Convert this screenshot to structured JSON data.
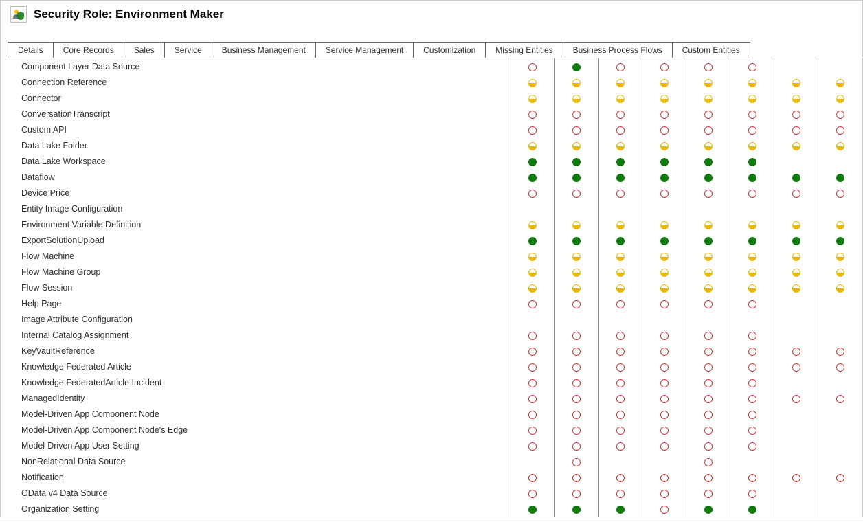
{
  "header": {
    "title": "Security Role: Environment Maker"
  },
  "tabs": [
    "Details",
    "Core Records",
    "Sales",
    "Service",
    "Business Management",
    "Service Management",
    "Customization",
    "Missing Entities",
    "Business Process Flows",
    "Custom Entities"
  ],
  "privilegeLevels": {
    "none": "None",
    "user": "User",
    "org": "Organization",
    "blank": ""
  },
  "entities": [
    {
      "name": "Component Layer Data Source",
      "privs": [
        "none",
        "org",
        "none",
        "none",
        "none",
        "none",
        "blank",
        "blank"
      ]
    },
    {
      "name": "Connection Reference",
      "privs": [
        "user",
        "user",
        "user",
        "user",
        "user",
        "user",
        "user",
        "user"
      ]
    },
    {
      "name": "Connector",
      "privs": [
        "user",
        "user",
        "user",
        "user",
        "user",
        "user",
        "user",
        "user"
      ]
    },
    {
      "name": "ConversationTranscript",
      "privs": [
        "none",
        "none",
        "none",
        "none",
        "none",
        "none",
        "none",
        "none"
      ]
    },
    {
      "name": "Custom API",
      "privs": [
        "none",
        "none",
        "none",
        "none",
        "none",
        "none",
        "none",
        "none"
      ]
    },
    {
      "name": "Data Lake Folder",
      "privs": [
        "user",
        "user",
        "user",
        "user",
        "user",
        "user",
        "user",
        "user"
      ]
    },
    {
      "name": "Data Lake Workspace",
      "privs": [
        "org",
        "org",
        "org",
        "org",
        "org",
        "org",
        "blank",
        "blank"
      ]
    },
    {
      "name": "Dataflow",
      "privs": [
        "org",
        "org",
        "org",
        "org",
        "org",
        "org",
        "org",
        "org"
      ]
    },
    {
      "name": "Device Price",
      "privs": [
        "none",
        "none",
        "none",
        "none",
        "none",
        "none",
        "none",
        "none"
      ]
    },
    {
      "name": "Entity Image Configuration",
      "privs": [
        "blank",
        "blank",
        "blank",
        "blank",
        "blank",
        "blank",
        "blank",
        "blank"
      ]
    },
    {
      "name": "Environment Variable Definition",
      "privs": [
        "user",
        "user",
        "user",
        "user",
        "user",
        "user",
        "user",
        "user"
      ]
    },
    {
      "name": "ExportSolutionUpload",
      "privs": [
        "org",
        "org",
        "org",
        "org",
        "org",
        "org",
        "org",
        "org"
      ]
    },
    {
      "name": "Flow Machine",
      "privs": [
        "user",
        "user",
        "user",
        "user",
        "user",
        "user",
        "user",
        "user"
      ]
    },
    {
      "name": "Flow Machine Group",
      "privs": [
        "user",
        "user",
        "user",
        "user",
        "user",
        "user",
        "user",
        "user"
      ]
    },
    {
      "name": "Flow Session",
      "privs": [
        "user",
        "user",
        "user",
        "user",
        "user",
        "user",
        "user",
        "user"
      ]
    },
    {
      "name": "Help Page",
      "privs": [
        "none",
        "none",
        "none",
        "none",
        "none",
        "none",
        "blank",
        "blank"
      ]
    },
    {
      "name": "Image Attribute Configuration",
      "privs": [
        "blank",
        "blank",
        "blank",
        "blank",
        "blank",
        "blank",
        "blank",
        "blank"
      ]
    },
    {
      "name": "Internal Catalog Assignment",
      "privs": [
        "none",
        "none",
        "none",
        "none",
        "none",
        "none",
        "blank",
        "blank"
      ]
    },
    {
      "name": "KeyVaultReference",
      "privs": [
        "none",
        "none",
        "none",
        "none",
        "none",
        "none",
        "none",
        "none"
      ]
    },
    {
      "name": "Knowledge Federated Article",
      "privs": [
        "none",
        "none",
        "none",
        "none",
        "none",
        "none",
        "none",
        "none"
      ]
    },
    {
      "name": "Knowledge FederatedArticle Incident",
      "privs": [
        "none",
        "none",
        "none",
        "none",
        "none",
        "none",
        "blank",
        "blank"
      ]
    },
    {
      "name": "ManagedIdentity",
      "privs": [
        "none",
        "none",
        "none",
        "none",
        "none",
        "none",
        "none",
        "none"
      ]
    },
    {
      "name": "Model-Driven App Component Node",
      "privs": [
        "none",
        "none",
        "none",
        "none",
        "none",
        "none",
        "blank",
        "blank"
      ]
    },
    {
      "name": "Model-Driven App Component Node's Edge",
      "privs": [
        "none",
        "none",
        "none",
        "none",
        "none",
        "none",
        "blank",
        "blank"
      ]
    },
    {
      "name": "Model-Driven App User Setting",
      "privs": [
        "none",
        "none",
        "none",
        "none",
        "none",
        "none",
        "blank",
        "blank"
      ]
    },
    {
      "name": "NonRelational Data Source",
      "privs": [
        "blank",
        "none",
        "blank",
        "blank",
        "none",
        "blank",
        "blank",
        "blank"
      ]
    },
    {
      "name": "Notification",
      "privs": [
        "none",
        "none",
        "none",
        "none",
        "none",
        "none",
        "none",
        "none"
      ]
    },
    {
      "name": "OData v4 Data Source",
      "privs": [
        "none",
        "none",
        "none",
        "none",
        "none",
        "none",
        "blank",
        "blank"
      ]
    },
    {
      "name": "Organization Setting",
      "privs": [
        "org",
        "org",
        "org",
        "none",
        "org",
        "org",
        "blank",
        "blank"
      ]
    }
  ]
}
